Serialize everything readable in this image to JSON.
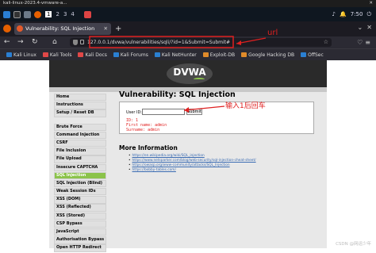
{
  "vm_window": {
    "title": "kali-linux-2023.4-vmware-a...",
    "close": "✕"
  },
  "top_panel": {
    "workspaces": [
      "1",
      "2",
      "3",
      "4"
    ],
    "active_workspace": "1",
    "clock": "7:50",
    "icons": [
      "kali-menu-icon",
      "terminal-icon",
      "files-icon",
      "firefox-icon"
    ]
  },
  "browser": {
    "tab_title": "Vulnerability: SQL Injection",
    "tab_close": "✕",
    "new_tab": "+",
    "url": "127.0.0.1/dvwa/vulnerabilities/sqli/?id=1&Submit=Submit#",
    "bookmarks": [
      {
        "label": "Kali Linux",
        "color": "#2a7fd4"
      },
      {
        "label": "Kali Tools",
        "color": "#e04848"
      },
      {
        "label": "Kali Docs",
        "color": "#e04848"
      },
      {
        "label": "Kali Forums",
        "color": "#2a7fd4"
      },
      {
        "label": "Kali NetHunter",
        "color": "#2a7fd4"
      },
      {
        "label": "Exploit-DB",
        "color": "#e08a2a"
      },
      {
        "label": "Google Hacking DB",
        "color": "#e08a2a"
      },
      {
        "label": "OffSec",
        "color": "#2a7fd4"
      }
    ]
  },
  "dvwa": {
    "logo_text": "DVWA",
    "menu": [
      {
        "label": "Home"
      },
      {
        "label": "Instructions"
      },
      {
        "label": "Setup / Reset DB"
      },
      {
        "label": "Brute Force"
      },
      {
        "label": "Command Injection"
      },
      {
        "label": "CSRF"
      },
      {
        "label": "File Inclusion"
      },
      {
        "label": "File Upload"
      },
      {
        "label": "Insecure CAPTCHA"
      },
      {
        "label": "SQL Injection"
      },
      {
        "label": "SQL Injection (Blind)"
      },
      {
        "label": "Weak Session IDs"
      },
      {
        "label": "XSS (DOM)"
      },
      {
        "label": "XSS (Reflected)"
      },
      {
        "label": "XSS (Stored)"
      },
      {
        "label": "CSP Bypass"
      },
      {
        "label": "JavaScript"
      },
      {
        "label": "Authorisation Bypass"
      },
      {
        "label": "Open HTTP Redirect"
      }
    ],
    "selected_menu": "SQL Injection",
    "page_title": "Vulnerability: SQL Injection",
    "user_id_label": "User ID:",
    "user_id_value": "",
    "submit_label": "Submit",
    "result_lines": [
      "ID: 1",
      "First name: admin",
      "Surname: admin"
    ],
    "more_info_title": "More Information",
    "links": [
      "https://en.wikipedia.org/wiki/SQL_injection",
      "https://www.netsparker.com/blog/web-security/sql-injection-cheat-sheet/",
      "https://owasp.org/www-community/attacks/SQL_Injection",
      "https://bobby-tables.com/"
    ]
  },
  "annotations": {
    "url_label": "url",
    "enter_label": "输入1后回车",
    "color": "#e02020"
  },
  "watermark": "CSDN @网运少年"
}
